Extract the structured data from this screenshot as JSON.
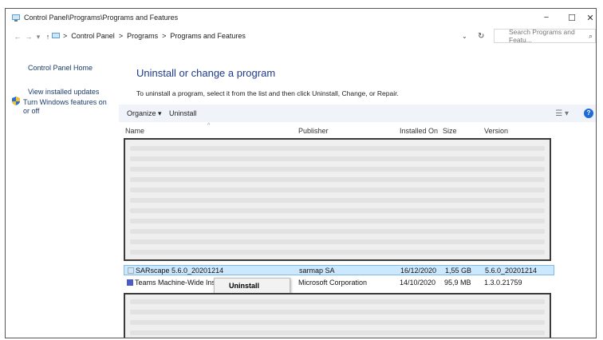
{
  "window": {
    "title": "Control Panel\\Programs\\Programs and Features",
    "minimize": "−",
    "maximize": "☐",
    "close": "✕"
  },
  "address": {
    "back": "←",
    "forward": "→",
    "recent": "▾",
    "up": "↑",
    "sep": ">",
    "crumbs": [
      "Control Panel",
      "Programs",
      "Programs and Features"
    ],
    "dropdown": "⌄",
    "refresh": "↻",
    "search_placeholder": "Search Programs and Featu...",
    "search_icon": "⌕"
  },
  "sidebar": {
    "home": "Control Panel Home",
    "updates": "View installed updates",
    "features": "Turn Windows features on or off"
  },
  "main": {
    "heading": "Uninstall or change a program",
    "description": "To uninstall a program, select it from the list and then click Uninstall, Change, or Repair."
  },
  "toolbar": {
    "organize": "Organize ▾",
    "uninstall": "Uninstall",
    "view_icon": "☰ ▾",
    "help": "?"
  },
  "columns": {
    "name": "Name",
    "publisher": "Publisher",
    "installed_on": "Installed On",
    "size": "Size",
    "version": "Version"
  },
  "rows": [
    {
      "name": "SARscape 5.6.0_20201214",
      "publisher": "sarmap SA",
      "installed": "16/12/2020",
      "size": "1,55 GB",
      "version": "5.6.0_20201214"
    },
    {
      "name": "Teams Machine-Wide Installer",
      "publisher": "Microsoft Corporation",
      "installed": "14/10/2020",
      "size": "95,9 MB",
      "version": "1.3.0.21759"
    }
  ],
  "context_menu": {
    "uninstall": "Uninstall"
  },
  "colors": {
    "selection": "#cce8ff",
    "link": "#1b3b6b",
    "heading": "#1e3a8a",
    "toolbar": "#f0f4fa"
  }
}
